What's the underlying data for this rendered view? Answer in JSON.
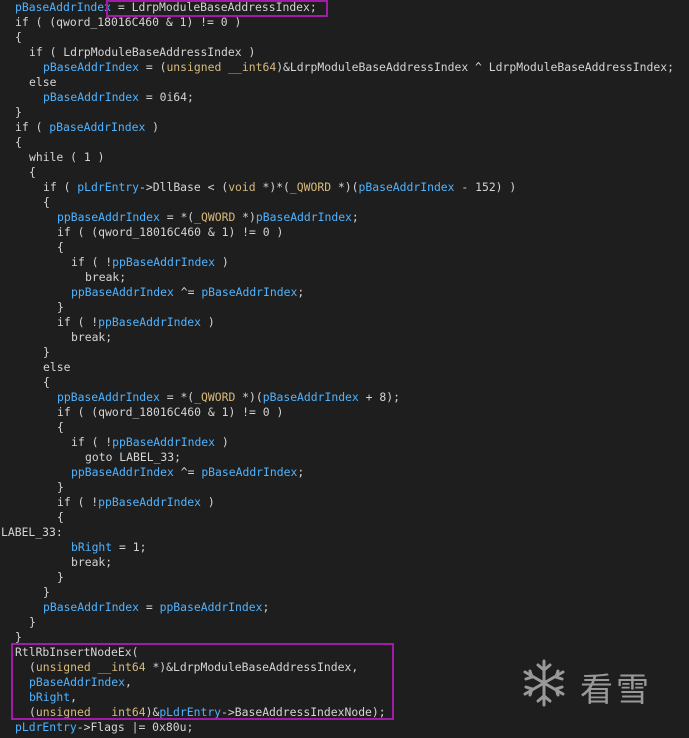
{
  "watermark_text": "看雪",
  "lines": [
    {
      "indent": 15,
      "tokens": [
        {
          "t": "pBaseAddrIndex",
          "c": "var"
        },
        {
          "t": " = ",
          "c": "plain"
        },
        {
          "t": "LdrpModuleBaseAddressIndex;",
          "c": "plain"
        }
      ]
    },
    {
      "indent": 15,
      "tokens": [
        {
          "t": "if ( (qword_18016C460 & 1) != 0 )",
          "c": "plain"
        }
      ]
    },
    {
      "indent": 15,
      "tokens": [
        {
          "t": "{",
          "c": "plain"
        }
      ]
    },
    {
      "indent": 29,
      "tokens": [
        {
          "t": "if ( LdrpModuleBaseAddressIndex )",
          "c": "plain"
        }
      ]
    },
    {
      "indent": 43,
      "tokens": [
        {
          "t": "pBaseAddrIndex",
          "c": "var"
        },
        {
          "t": " = (",
          "c": "plain"
        },
        {
          "t": "unsigned __int64",
          "c": "kw"
        },
        {
          "t": ")&LdrpModuleBaseAddressIndex ^ LdrpModuleBaseAddressIndex;",
          "c": "plain"
        }
      ]
    },
    {
      "indent": 29,
      "tokens": [
        {
          "t": "else",
          "c": "plain"
        }
      ]
    },
    {
      "indent": 43,
      "tokens": [
        {
          "t": "pBaseAddrIndex",
          "c": "var"
        },
        {
          "t": " = 0i64;",
          "c": "plain"
        }
      ]
    },
    {
      "indent": 15,
      "tokens": [
        {
          "t": "}",
          "c": "plain"
        }
      ]
    },
    {
      "indent": 15,
      "tokens": [
        {
          "t": "if ( ",
          "c": "plain"
        },
        {
          "t": "pBaseAddrIndex",
          "c": "var"
        },
        {
          "t": " )",
          "c": "plain"
        }
      ]
    },
    {
      "indent": 15,
      "tokens": [
        {
          "t": "{",
          "c": "plain"
        }
      ]
    },
    {
      "indent": 29,
      "tokens": [
        {
          "t": "while ( 1 )",
          "c": "plain"
        }
      ]
    },
    {
      "indent": 29,
      "tokens": [
        {
          "t": "{",
          "c": "plain"
        }
      ]
    },
    {
      "indent": 43,
      "tokens": [
        {
          "t": "if ( ",
          "c": "plain"
        },
        {
          "t": "pLdrEntry",
          "c": "var"
        },
        {
          "t": "->DllBase < (",
          "c": "plain"
        },
        {
          "t": "void",
          "c": "kw"
        },
        {
          "t": " *)*(",
          "c": "plain"
        },
        {
          "t": "_QWORD",
          "c": "kw"
        },
        {
          "t": " *)(",
          "c": "plain"
        },
        {
          "t": "pBaseAddrIndex",
          "c": "var"
        },
        {
          "t": " - 152) )",
          "c": "plain"
        }
      ]
    },
    {
      "indent": 43,
      "tokens": [
        {
          "t": "{",
          "c": "plain"
        }
      ]
    },
    {
      "indent": 57,
      "tokens": [
        {
          "t": "ppBaseAddrIndex",
          "c": "var"
        },
        {
          "t": " = *(",
          "c": "plain"
        },
        {
          "t": "_QWORD",
          "c": "kw"
        },
        {
          "t": " *)",
          "c": "plain"
        },
        {
          "t": "pBaseAddrIndex",
          "c": "var"
        },
        {
          "t": ";",
          "c": "plain"
        }
      ]
    },
    {
      "indent": 57,
      "tokens": [
        {
          "t": "if ( (qword_18016C460 & 1) != 0 )",
          "c": "plain"
        }
      ]
    },
    {
      "indent": 57,
      "tokens": [
        {
          "t": "{",
          "c": "plain"
        }
      ]
    },
    {
      "indent": 71,
      "tokens": [
        {
          "t": "if ( !",
          "c": "plain"
        },
        {
          "t": "ppBaseAddrIndex",
          "c": "var"
        },
        {
          "t": " )",
          "c": "plain"
        }
      ]
    },
    {
      "indent": 85,
      "tokens": [
        {
          "t": "break;",
          "c": "plain"
        }
      ]
    },
    {
      "indent": 71,
      "tokens": [
        {
          "t": "ppBaseAddrIndex",
          "c": "var"
        },
        {
          "t": " ^= ",
          "c": "plain"
        },
        {
          "t": "pBaseAddrIndex",
          "c": "var"
        },
        {
          "t": ";",
          "c": "plain"
        }
      ]
    },
    {
      "indent": 57,
      "tokens": [
        {
          "t": "}",
          "c": "plain"
        }
      ]
    },
    {
      "indent": 57,
      "tokens": [
        {
          "t": "if ( !",
          "c": "plain"
        },
        {
          "t": "ppBaseAddrIndex",
          "c": "var"
        },
        {
          "t": " )",
          "c": "plain"
        }
      ]
    },
    {
      "indent": 71,
      "tokens": [
        {
          "t": "break;",
          "c": "plain"
        }
      ]
    },
    {
      "indent": 43,
      "tokens": [
        {
          "t": "}",
          "c": "plain"
        }
      ]
    },
    {
      "indent": 43,
      "tokens": [
        {
          "t": "else",
          "c": "plain"
        }
      ]
    },
    {
      "indent": 43,
      "tokens": [
        {
          "t": "{",
          "c": "plain"
        }
      ]
    },
    {
      "indent": 57,
      "tokens": [
        {
          "t": "ppBaseAddrIndex",
          "c": "var"
        },
        {
          "t": " = *(",
          "c": "plain"
        },
        {
          "t": "_QWORD",
          "c": "kw"
        },
        {
          "t": " *)(",
          "c": "plain"
        },
        {
          "t": "pBaseAddrIndex",
          "c": "var"
        },
        {
          "t": " + 8);",
          "c": "plain"
        }
      ]
    },
    {
      "indent": 57,
      "tokens": [
        {
          "t": "if ( (qword_18016C460 & 1) != 0 )",
          "c": "plain"
        }
      ]
    },
    {
      "indent": 57,
      "tokens": [
        {
          "t": "{",
          "c": "plain"
        }
      ]
    },
    {
      "indent": 71,
      "tokens": [
        {
          "t": "if ( !",
          "c": "plain"
        },
        {
          "t": "ppBaseAddrIndex",
          "c": "var"
        },
        {
          "t": " )",
          "c": "plain"
        }
      ]
    },
    {
      "indent": 85,
      "tokens": [
        {
          "t": "goto LABEL_33;",
          "c": "plain"
        }
      ]
    },
    {
      "indent": 71,
      "tokens": [
        {
          "t": "ppBaseAddrIndex",
          "c": "var"
        },
        {
          "t": " ^= ",
          "c": "plain"
        },
        {
          "t": "pBaseAddrIndex",
          "c": "var"
        },
        {
          "t": ";",
          "c": "plain"
        }
      ]
    },
    {
      "indent": 57,
      "tokens": [
        {
          "t": "}",
          "c": "plain"
        }
      ]
    },
    {
      "indent": 57,
      "tokens": [
        {
          "t": "if ( !",
          "c": "plain"
        },
        {
          "t": "ppBaseAddrIndex",
          "c": "var"
        },
        {
          "t": " )",
          "c": "plain"
        }
      ]
    },
    {
      "indent": 57,
      "tokens": [
        {
          "t": "{",
          "c": "plain"
        }
      ]
    },
    {
      "indent": 1,
      "tokens": [
        {
          "t": "LABEL_33:",
          "c": "plain"
        }
      ]
    },
    {
      "indent": 71,
      "tokens": [
        {
          "t": "bRight",
          "c": "var"
        },
        {
          "t": " = 1;",
          "c": "plain"
        }
      ]
    },
    {
      "indent": 71,
      "tokens": [
        {
          "t": "break;",
          "c": "plain"
        }
      ]
    },
    {
      "indent": 57,
      "tokens": [
        {
          "t": "}",
          "c": "plain"
        }
      ]
    },
    {
      "indent": 43,
      "tokens": [
        {
          "t": "}",
          "c": "plain"
        }
      ]
    },
    {
      "indent": 43,
      "tokens": [
        {
          "t": "pBaseAddrIndex",
          "c": "var"
        },
        {
          "t": " = ",
          "c": "plain"
        },
        {
          "t": "ppBaseAddrIndex",
          "c": "var"
        },
        {
          "t": ";",
          "c": "plain"
        }
      ]
    },
    {
      "indent": 29,
      "tokens": [
        {
          "t": "}",
          "c": "plain"
        }
      ]
    },
    {
      "indent": 15,
      "tokens": [
        {
          "t": "}",
          "c": "plain"
        }
      ]
    },
    {
      "indent": 15,
      "tokens": [
        {
          "t": "RtlRbInsertNodeEx(",
          "c": "plain"
        }
      ]
    },
    {
      "indent": 29,
      "tokens": [
        {
          "t": "(",
          "c": "plain"
        },
        {
          "t": "unsigned __int64",
          "c": "kw"
        },
        {
          "t": " *)&LdrpModuleBaseAddressIndex,",
          "c": "plain"
        }
      ]
    },
    {
      "indent": 29,
      "tokens": [
        {
          "t": "pBaseAddrIndex",
          "c": "var"
        },
        {
          "t": ",",
          "c": "plain"
        }
      ]
    },
    {
      "indent": 29,
      "tokens": [
        {
          "t": "bRight",
          "c": "var"
        },
        {
          "t": ",",
          "c": "plain"
        }
      ]
    },
    {
      "indent": 29,
      "tokens": [
        {
          "t": "(",
          "c": "plain"
        },
        {
          "t": "unsigned __int64",
          "c": "kw"
        },
        {
          "t": ")&",
          "c": "plain"
        },
        {
          "t": "pLdrEntry",
          "c": "var"
        },
        {
          "t": "->BaseAddressIndexNode);",
          "c": "plain"
        }
      ]
    },
    {
      "indent": 15,
      "tokens": [
        {
          "t": "pLdrEntry",
          "c": "var"
        },
        {
          "t": "->Flags |= 0x80u;",
          "c": "plain"
        }
      ]
    }
  ],
  "colors": {
    "background": "#1e1e1e",
    "variable": "#4fb3ff",
    "keyword": "#d7ba7d",
    "plain": "#d4d4d4",
    "highlight_box": "#a01ca8"
  }
}
